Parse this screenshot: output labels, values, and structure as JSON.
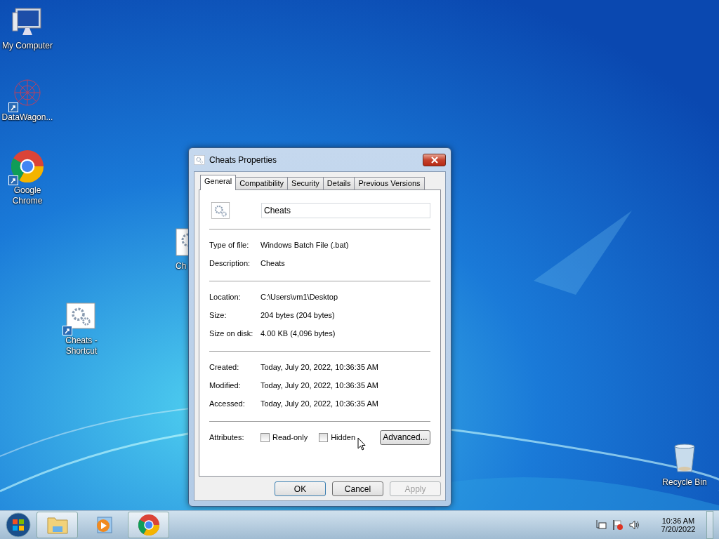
{
  "desktop_icons": [
    {
      "kind": "computer",
      "label": "My Computer",
      "shortcut": false
    },
    {
      "kind": "network",
      "label": "DataWagon...",
      "shortcut": true
    },
    {
      "kind": "chrome",
      "label": "Google Chrome",
      "shortcut": true
    },
    {
      "kind": "batch-partial",
      "label": "Ch",
      "shortcut": false
    },
    {
      "kind": "batch",
      "label": "Cheats - Shortcut",
      "shortcut": true
    },
    {
      "kind": "recycle",
      "label": "Recycle Bin",
      "shortcut": false
    }
  ],
  "dialog": {
    "title": "Cheats Properties",
    "tabs": [
      {
        "label": "General",
        "selected": true
      },
      {
        "label": "Compatibility",
        "selected": false
      },
      {
        "label": "Security",
        "selected": false
      },
      {
        "label": "Details",
        "selected": false
      },
      {
        "label": "Previous Versions",
        "selected": false
      }
    ],
    "file_name": "Cheats",
    "groups": [
      [
        {
          "label": "Type of file:",
          "value": "Windows Batch File (.bat)"
        },
        {
          "label": "Description:",
          "value": "Cheats"
        }
      ],
      [
        {
          "label": "Location:",
          "value": "C:\\Users\\vm1\\Desktop"
        },
        {
          "label": "Size:",
          "value": "204 bytes (204 bytes)"
        },
        {
          "label": "Size on disk:",
          "value": "4.00 KB (4,096 bytes)"
        }
      ],
      [
        {
          "label": "Created:",
          "value": "Today, July 20, 2022, 10:36:35 AM"
        },
        {
          "label": "Modified:",
          "value": "Today, July 20, 2022, 10:36:35 AM"
        },
        {
          "label": "Accessed:",
          "value": "Today, July 20, 2022, 10:36:35 AM"
        }
      ]
    ],
    "attributes": {
      "label": "Attributes:",
      "checkboxes": [
        {
          "label": "Read-only",
          "checked": false
        },
        {
          "label": "Hidden",
          "checked": false
        }
      ],
      "advanced": "Advanced..."
    },
    "buttons": [
      {
        "label": "OK",
        "default": true,
        "disabled": false
      },
      {
        "label": "Cancel",
        "default": false,
        "disabled": false
      },
      {
        "label": "Apply",
        "default": false,
        "disabled": true
      }
    ]
  },
  "taskbar": {
    "items": [
      {
        "kind": "explorer",
        "active": true
      },
      {
        "kind": "media",
        "active": false
      },
      {
        "kind": "chrome",
        "active": true
      }
    ],
    "tray": [
      {
        "kind": "network"
      },
      {
        "kind": "flag"
      },
      {
        "kind": "volume"
      }
    ],
    "time": "10:36 AM",
    "date": "7/20/2022"
  }
}
